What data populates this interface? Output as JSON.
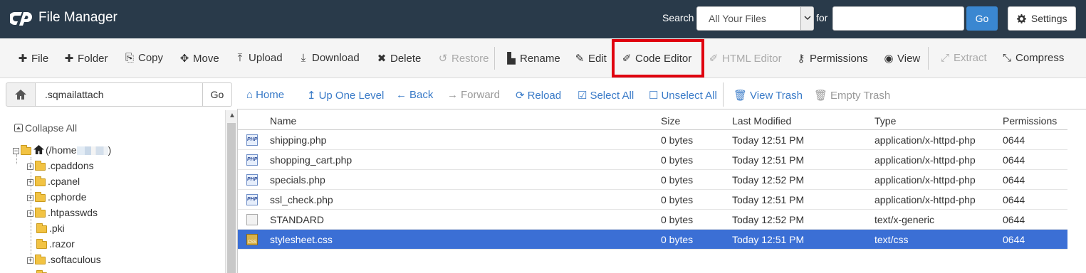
{
  "header": {
    "app_title": "File Manager",
    "search_label": "Search",
    "search_scope": "All Your Files",
    "for_label": "for",
    "search_value": "",
    "go_label": "Go",
    "settings_label": "Settings"
  },
  "toolbar": {
    "file": "File",
    "folder": "Folder",
    "copy": "Copy",
    "move": "Move",
    "upload": "Upload",
    "download": "Download",
    "delete": "Delete",
    "restore": "Restore",
    "rename": "Rename",
    "edit": "Edit",
    "code_editor": "Code Editor",
    "html_editor": "HTML Editor",
    "permissions": "Permissions",
    "view": "View",
    "extract": "Extract",
    "compress": "Compress"
  },
  "path_bar": {
    "path": ".sqmailattach",
    "go_label": "Go"
  },
  "nav": {
    "home": "Home",
    "up_one_level": "Up One Level",
    "back": "Back",
    "forward": "Forward",
    "reload": "Reload",
    "select_all": "Select All",
    "unselect_all": "Unselect All",
    "view_trash": "View Trash",
    "empty_trash": "Empty Trash"
  },
  "tree": {
    "collapse_all": "Collapse All",
    "root_prefix": "(/home",
    "root_suffix": ")",
    "folders": [
      ".cpaddons",
      ".cpanel",
      ".cphorde",
      ".htpasswds",
      ".pki",
      ".razor",
      ".softaculous"
    ]
  },
  "table": {
    "columns": [
      "Name",
      "Size",
      "Last Modified",
      "Type",
      "Permissions"
    ],
    "rows": [
      {
        "icon": "php-file-icon",
        "name": "shipping.php",
        "size": "0 bytes",
        "modified": "Today 12:51 PM",
        "type": "application/x-httpd-php",
        "perms": "0644"
      },
      {
        "icon": "php-file-icon",
        "name": "shopping_cart.php",
        "size": "0 bytes",
        "modified": "Today 12:51 PM",
        "type": "application/x-httpd-php",
        "perms": "0644"
      },
      {
        "icon": "php-file-icon",
        "name": "specials.php",
        "size": "0 bytes",
        "modified": "Today 12:52 PM",
        "type": "application/x-httpd-php",
        "perms": "0644"
      },
      {
        "icon": "php-file-icon",
        "name": "ssl_check.php",
        "size": "0 bytes",
        "modified": "Today 12:51 PM",
        "type": "application/x-httpd-php",
        "perms": "0644"
      },
      {
        "icon": "text-file-icon",
        "name": "STANDARD",
        "size": "0 bytes",
        "modified": "Today 12:52 PM",
        "type": "text/x-generic",
        "perms": "0644"
      },
      {
        "icon": "css-file-icon",
        "name": "stylesheet.css",
        "size": "0 bytes",
        "modified": "Today 12:51 PM",
        "type": "text/css",
        "perms": "0644"
      }
    ],
    "selected_index": 5
  },
  "icon_text": {
    "php": "PHP",
    "css": "CSS"
  },
  "colors": {
    "header_bg": "#293a4a",
    "accent_blue": "#3a87d1",
    "selected_row": "#3b6fd5",
    "highlight_border": "#e0000f"
  }
}
